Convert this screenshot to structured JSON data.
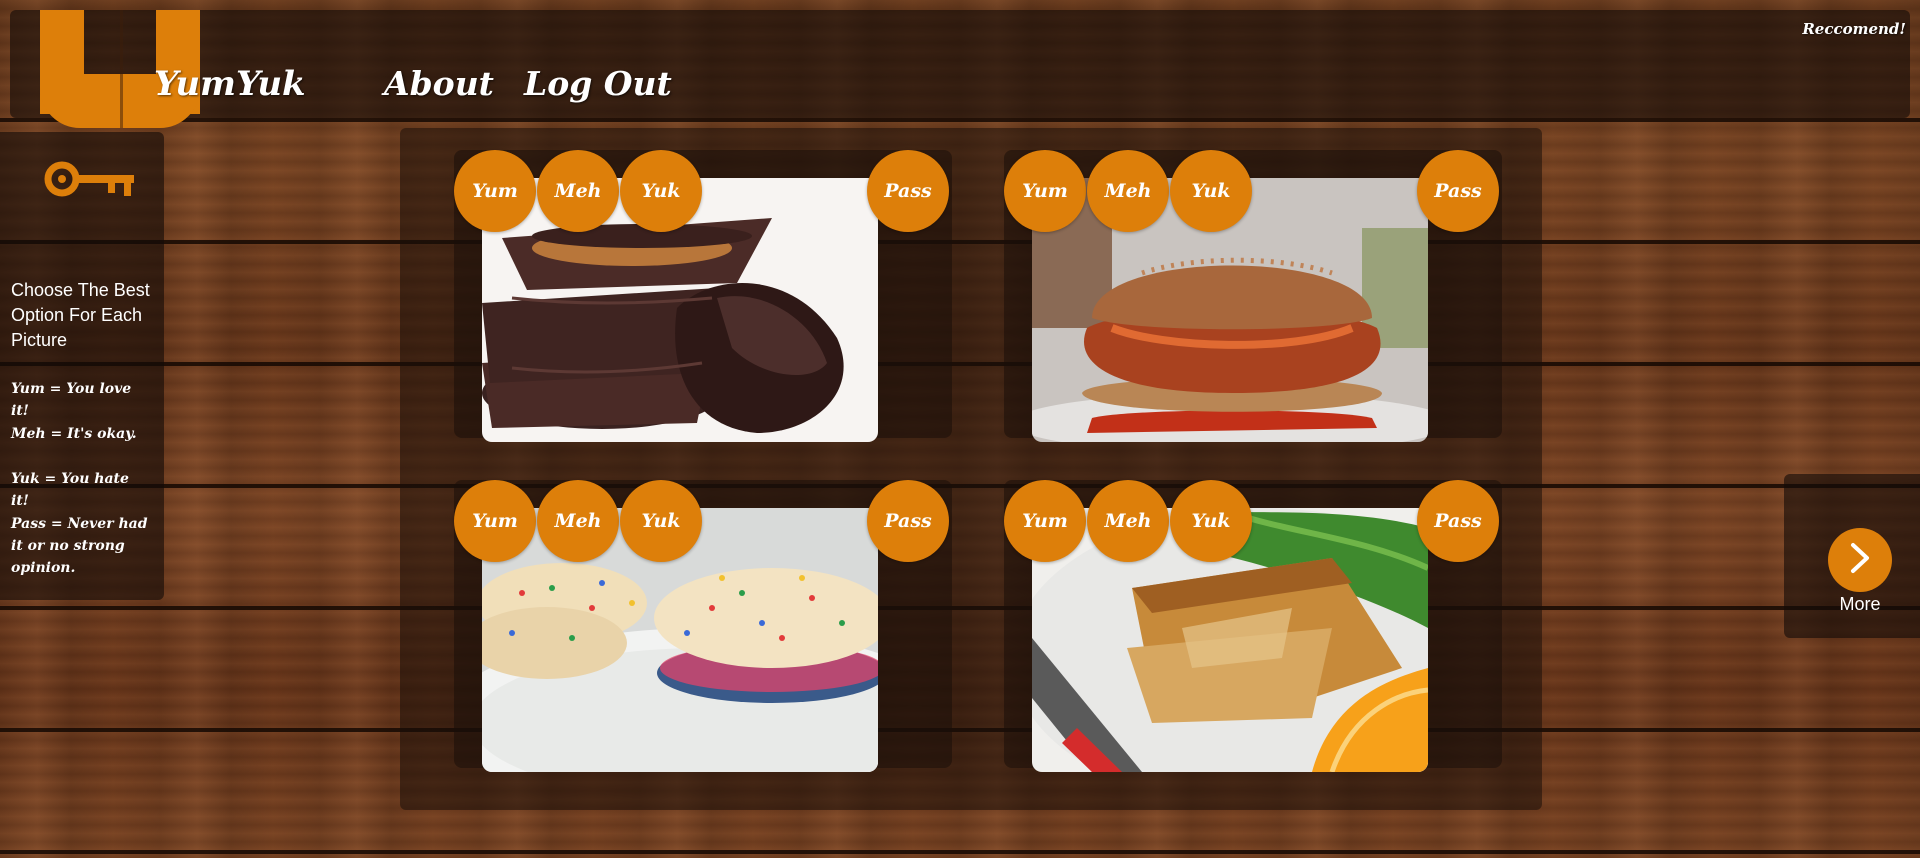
{
  "header": {
    "brand": "YumYuk",
    "nav": {
      "about": "About",
      "logout": "Log Out"
    },
    "recommend": "Reccomend!"
  },
  "legend": {
    "icon": "key-icon",
    "intro": "Choose The Best Option For Each Picture",
    "lines": [
      "Yum = You love it!",
      "Meh = It's okay.",
      "Yuk = You hate it!",
      "Pass = Never had it or no strong opinion."
    ]
  },
  "cards": [
    {
      "image": "chocolate-peanut-butter-cups",
      "votes": [
        "Yum",
        "Meh",
        "Yuk"
      ],
      "pass": "Pass"
    },
    {
      "image": "pulled-chicken-sandwich",
      "votes": [
        "Yum",
        "Meh",
        "Yuk"
      ],
      "pass": "Pass"
    },
    {
      "image": "funfetti-cookie-sandwiches",
      "votes": [
        "Yum",
        "Meh",
        "Yuk"
      ],
      "pass": "Pass"
    },
    {
      "image": "potato-frittata-with-orange",
      "votes": [
        "Yum",
        "Meh",
        "Yuk"
      ],
      "pass": "Pass"
    }
  ],
  "more": {
    "label": "More",
    "icon": "chevron-right-icon"
  },
  "colors": {
    "accent": "#dd7f0a",
    "panel": "rgba(20,12,8,0.62)",
    "text": "#ffffff"
  }
}
